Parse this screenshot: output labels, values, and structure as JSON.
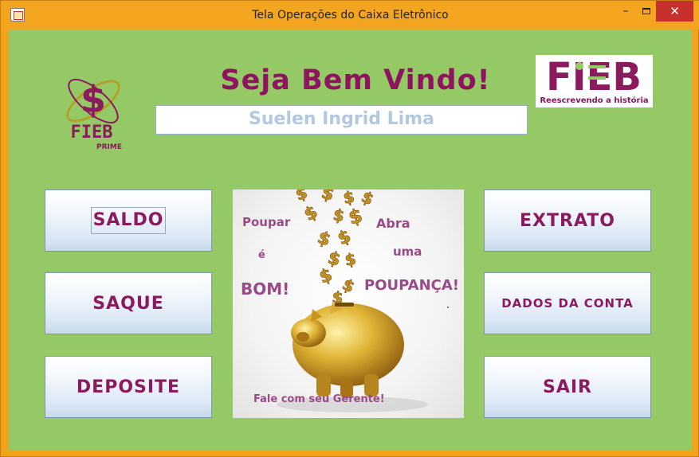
{
  "window": {
    "title": "Tela Operações do Caixa Eletrônico",
    "controls": {
      "minimize": "–",
      "close": "✕"
    }
  },
  "header": {
    "welcome": "Seja Bem Vindo!",
    "customer_name": "Suelen Ingrid Lima",
    "logo_left_text": "FIEB",
    "logo_left_sub": "PRIME",
    "logo_right_text": "FIEB",
    "logo_right_tagline": "Reescrevendo a história"
  },
  "buttons": {
    "saldo": "SALDO",
    "saque": "SAQUE",
    "deposite": "DEPOSITE",
    "extrato": "EXTRATO",
    "dados": "DADOS DA CONTA",
    "sair": "SAIR"
  },
  "poster": {
    "left_1": "Poupar",
    "left_2": "é",
    "left_3": "BOM!",
    "right_1": "Abra",
    "right_2": "uma",
    "right_3": "POUPANÇA!",
    "footer": "Fale com seu Gerente!"
  },
  "colors": {
    "background": "#95c965",
    "accent": "#8b1a5f",
    "frame": "#f3a51f",
    "close": "#c7312b"
  }
}
